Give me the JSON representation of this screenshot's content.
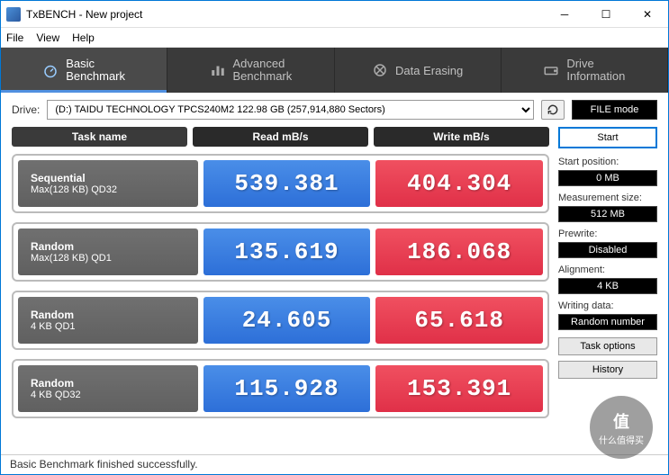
{
  "window": {
    "title": "TxBENCH - New project"
  },
  "menu": {
    "file": "File",
    "view": "View",
    "help": "Help"
  },
  "tabs": {
    "basic": "Basic\nBenchmark",
    "advanced": "Advanced\nBenchmark",
    "erasing": "Data Erasing",
    "drive": "Drive\nInformation"
  },
  "drive": {
    "label": "Drive:",
    "value": "(D:) TAIDU TECHNOLOGY TPCS240M2  122.98 GB (257,914,880 Sectors)",
    "filemode": "FILE mode"
  },
  "headers": {
    "task": "Task name",
    "read": "Read mB/s",
    "write": "Write mB/s"
  },
  "rows": [
    {
      "name": "Sequential",
      "sub": "Max(128 KB) QD32",
      "read": "539.381",
      "write": "404.304"
    },
    {
      "name": "Random",
      "sub": "Max(128 KB) QD1",
      "read": "135.619",
      "write": "186.068"
    },
    {
      "name": "Random",
      "sub": "4 KB QD1",
      "read": "24.605",
      "write": "65.618"
    },
    {
      "name": "Random",
      "sub": "4 KB QD32",
      "read": "115.928",
      "write": "153.391"
    }
  ],
  "side": {
    "start": "Start",
    "startpos_label": "Start position:",
    "startpos": "0 MB",
    "measure_label": "Measurement size:",
    "measure": "512 MB",
    "prewrite_label": "Prewrite:",
    "prewrite": "Disabled",
    "alignment_label": "Alignment:",
    "alignment": "4 KB",
    "writing_label": "Writing data:",
    "writing": "Random number",
    "taskopt": "Task options",
    "history": "History"
  },
  "status": "Basic Benchmark finished successfully.",
  "watermark": {
    "top": "值",
    "bottom": "什么值得买"
  }
}
